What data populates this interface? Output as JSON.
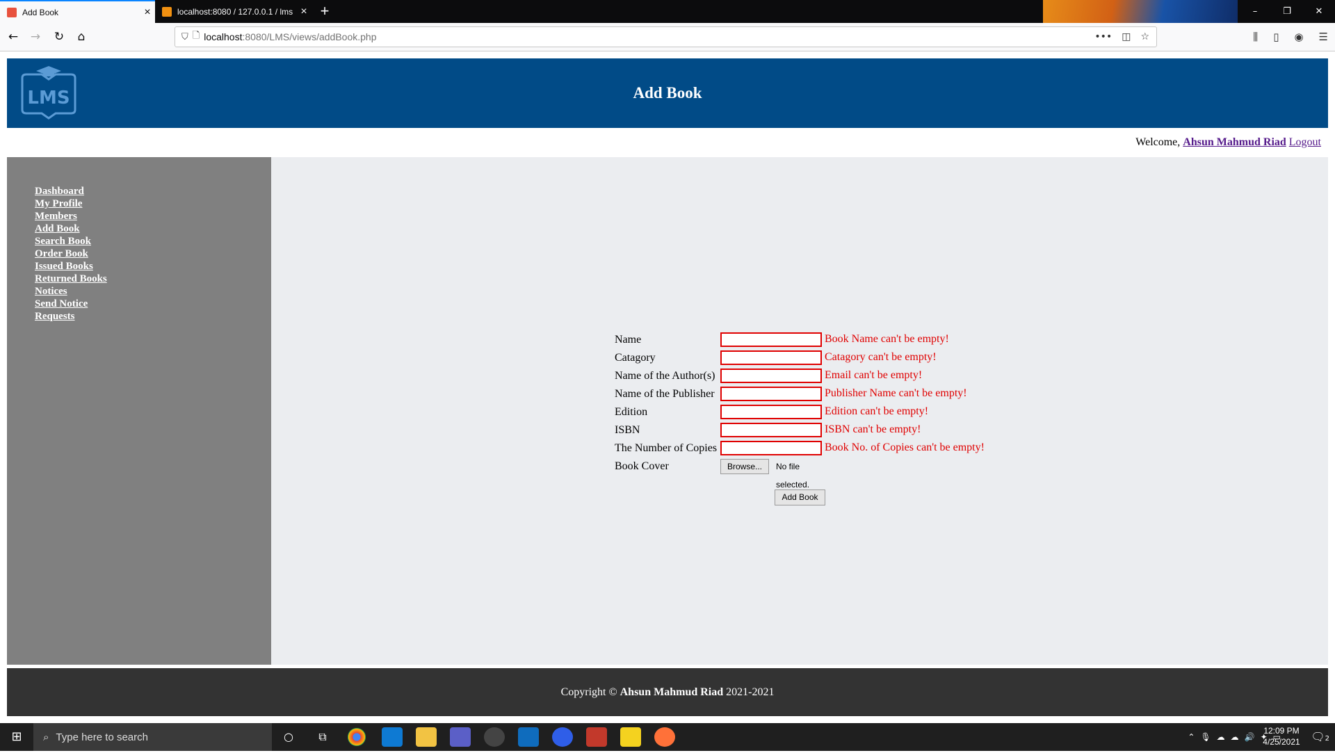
{
  "browser": {
    "tabs": [
      {
        "title": "Add Book",
        "active": true
      },
      {
        "title": "localhost:8080 / 127.0.0.1 / lms",
        "active": false
      }
    ],
    "new_tab_symbol": "+",
    "url_host": "localhost",
    "url_rest": ":8080/LMS/views/addBook.php",
    "window_controls": [
      "–",
      "❐",
      "✕"
    ],
    "page_actions": [
      "•••",
      "pocket-icon",
      "star-icon"
    ]
  },
  "header": {
    "title": "Add Book",
    "logo_text": "LMS",
    "accent_color": "#014b87"
  },
  "welcome": {
    "prefix": "Welcome,",
    "user_name": "Ahsun Mahmud Riad",
    "logout": "Logout"
  },
  "sidebar": {
    "items": [
      {
        "label": "Dashboard"
      },
      {
        "label": "My Profile"
      },
      {
        "label": "Members"
      },
      {
        "label": "Add Book"
      },
      {
        "label": "Search Book"
      },
      {
        "label": "Order Book"
      },
      {
        "label": "Issued Books"
      },
      {
        "label": "Returned Books"
      },
      {
        "label": "Notices"
      },
      {
        "label": "Send Notice"
      },
      {
        "label": "Requests"
      }
    ]
  },
  "form": {
    "fields": [
      {
        "label": "Name",
        "value": "",
        "error": "Book Name can't be empty!"
      },
      {
        "label": "Catagory",
        "value": "",
        "error": "Catagory can't be empty!"
      },
      {
        "label": "Name of the Author(s)",
        "value": "",
        "error": "Email can't be empty!"
      },
      {
        "label": "Name of the Publisher",
        "value": "",
        "error": "Publisher Name can't be empty!"
      },
      {
        "label": "Edition",
        "value": "",
        "error": "Edition can't be empty!"
      },
      {
        "label": "ISBN",
        "value": "",
        "error": "ISBN can't be empty!"
      },
      {
        "label": "The Number of Copies",
        "value": "",
        "error": "Book No. of Copies can't be empty!"
      }
    ],
    "cover": {
      "label": "Book Cover",
      "browse": "Browse...",
      "status": "No file selected."
    },
    "submit": "Add Book",
    "error_color": "#e00000"
  },
  "footer": {
    "prefix": "Copyright ©",
    "name": "Ahsun Mahmud Riad",
    "years": "2021-2021"
  },
  "taskbar": {
    "search_placeholder": "Type here to search",
    "time": "12:09 PM",
    "date": "4/25/2021",
    "notification_count": "2"
  }
}
